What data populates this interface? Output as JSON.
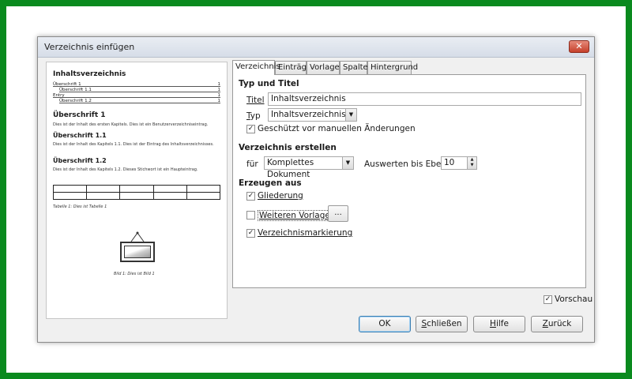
{
  "dialog": {
    "title": "Verzeichnis einfügen",
    "close": "✕"
  },
  "preview": {
    "toc_title": "Inhaltsverzeichnis",
    "toc_rows": [
      {
        "text": "Überschrift 1",
        "num": "1",
        "indent": false
      },
      {
        "text": "Überschrift 1.1",
        "num": "1",
        "indent": true
      },
      {
        "text": "Entry",
        "num": "1",
        "indent": false
      },
      {
        "text": "Überschrift 1.2",
        "num": "1",
        "indent": true
      }
    ],
    "h1": "Überschrift 1",
    "p1": "Dies ist der Inhalt des ersten Kapitels. Dies ist ein Benutzerverzeichniseintrag.",
    "h11": "Überschrift 1.1",
    "p11": "Dies ist der Inhalt des Kapitels 1.1. Dies ist der Eintrag des Inhaltsverzeichnisses.",
    "h12": "Überschrift 1.2",
    "p12": "Dies ist der Inhalt des Kapitels 1.2. Dieses Stichwort ist ein Haupteintrag.",
    "table_caption": "Tabelle 1: Dies ist Tabelle 1",
    "image_caption": "Bild 1: Dies ist Bild 1"
  },
  "tabs": [
    {
      "label": "Verzeichnis",
      "active": true
    },
    {
      "label": "Einträge",
      "active": false
    },
    {
      "label": "Vorlagen",
      "active": false
    },
    {
      "label": "Spalten",
      "active": false
    },
    {
      "label": "Hintergrund",
      "active": false
    }
  ],
  "type_section": {
    "heading": "Typ und Titel",
    "title_label": "Titel",
    "title_value": "Inhaltsverzeichnis",
    "type_label": "Typ",
    "type_value": "Inhaltsverzeichnis",
    "protect_label": "Geschützt vor manuellen Änderungen",
    "protect_checked": true
  },
  "create_section": {
    "heading": "Verzeichnis erstellen",
    "for_label": "für",
    "for_value": "Komplettes Dokument",
    "level_label": "Auswerten bis Ebene",
    "level_value": "10"
  },
  "from_section": {
    "heading": "Erzeugen aus",
    "outline_label": "Gliederung",
    "outline_checked": true,
    "styles_label": "Weiteren Vorlagen",
    "styles_checked": false,
    "styles_button": "...",
    "marks_label": "Verzeichnismarkierung",
    "marks_checked": true
  },
  "preview_toggle": {
    "label": "Vorschau",
    "checked": true
  },
  "buttons": {
    "ok": "OK",
    "close": "Schließen",
    "help": "Hilfe",
    "back": "Zurück"
  },
  "icons": {
    "check": "✓",
    "dropdown": "▼",
    "spin_up": "▲",
    "spin_down": "▼"
  }
}
